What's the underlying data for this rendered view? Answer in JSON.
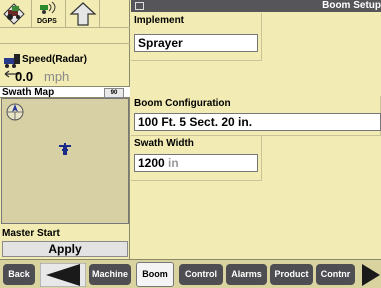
{
  "header": {
    "title": "Boom Setup"
  },
  "status": {
    "dgps_label": "DGPS"
  },
  "speed": {
    "label": "Speed(Radar)",
    "value": "0.0",
    "unit": "mph"
  },
  "swath_map": {
    "title": "Swath Map",
    "zoom": "90"
  },
  "master": {
    "label": "Master Start",
    "button": "Apply"
  },
  "implement": {
    "label": "Implement",
    "value": "Sprayer"
  },
  "boom_config": {
    "label": "Boom Configuration",
    "value": "100 Ft. 5 Sect. 20 in."
  },
  "swath_width": {
    "label": "Swath Width",
    "value": "1200",
    "unit": "in"
  },
  "nav": {
    "back": "Back",
    "machine": "Machine",
    "boom": "Boom",
    "control": "Control",
    "alarms": "Alarms",
    "product": "Product",
    "contnr": "Contnr"
  },
  "colors": {
    "background": "#f2ebb3",
    "titlebar": "#55555a",
    "nav_button": "#4e4e52",
    "map": "#d6d0a4",
    "vehicle": "#1a2a8a"
  }
}
